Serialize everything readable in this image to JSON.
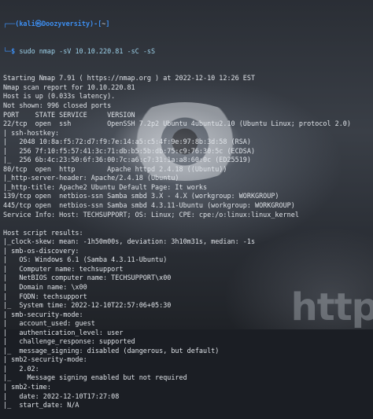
{
  "prompt": {
    "top_left": "┌──(",
    "user_host": "kali㉿Doozyversity",
    "mid": ")-[",
    "path": "~",
    "end": "]",
    "arrow": "└─$",
    "command": "sudo nmap -sV 10.10.220.81 -sC -sS"
  },
  "output_lines": [
    "Starting Nmap 7.91 ( https://nmap.org ) at 2022-12-10 12:26 EST",
    "Nmap scan report for 10.10.220.81",
    "Host is up (0.033s latency).",
    "Not shown: 996 closed ports",
    "PORT    STATE SERVICE     VERSION",
    "22/tcp  open  ssh         OpenSSH 7.2p2 Ubuntu 4ubuntu2.10 (Ubuntu Linux; protocol 2.0)",
    "| ssh-hostkey:",
    "|   2048 10:8a:f5:72:d7:f9:7e:14:a5:c5:4f:9e:97:8b:3d:58 (RSA)",
    "|   256 7f:10:f5:57:41:3c:71:db:b5:5b:db:75:c9:76:30:5c (ECDSA)",
    "|_  256 6b:4c:23:50:6f:36:00:7c:a6:c7:31:1a:a8:60:0c (ED25519)",
    "80/tcp  open  http        Apache httpd 2.4.18 ((Ubuntu))",
    "|_http-server-header: Apache/2.4.18 (Ubuntu)",
    "|_http-title: Apache2 Ubuntu Default Page: It works",
    "139/tcp open  netbios-ssn Samba smbd 3.X - 4.X (workgroup: WORKGROUP)",
    "445/tcp open  netbios-ssn Samba smbd 4.3.11-Ubuntu (workgroup: WORKGROUP)",
    "Service Info: Host: TECHSUPPORT; OS: Linux; CPE: cpe:/o:linux:linux_kernel",
    "",
    "Host script results:",
    "|_clock-skew: mean: -1h50m00s, deviation: 3h10m31s, median: -1s",
    "| smb-os-discovery:",
    "|   OS: Windows 6.1 (Samba 4.3.11-Ubuntu)",
    "|   Computer name: techsupport",
    "|   NetBIOS computer name: TECHSUPPORT\\x00",
    "|   Domain name: \\x00",
    "|   FQDN: techsupport",
    "|_  System time: 2022-12-10T22:57:06+05:30",
    "| smb-security-mode:",
    "|   account_used: guest",
    "|   authentication_level: user",
    "|   challenge_response: supported",
    "|_  message_signing: disabled (dangerous, but default)",
    "| smb2-security-mode:",
    "|   2.02:",
    "|_    Message signing enabled but not required",
    "| smb2-time:",
    "|   date: 2022-12-10T17:27:08",
    "|_  start_date: N/A"
  ],
  "watermark": "http"
}
